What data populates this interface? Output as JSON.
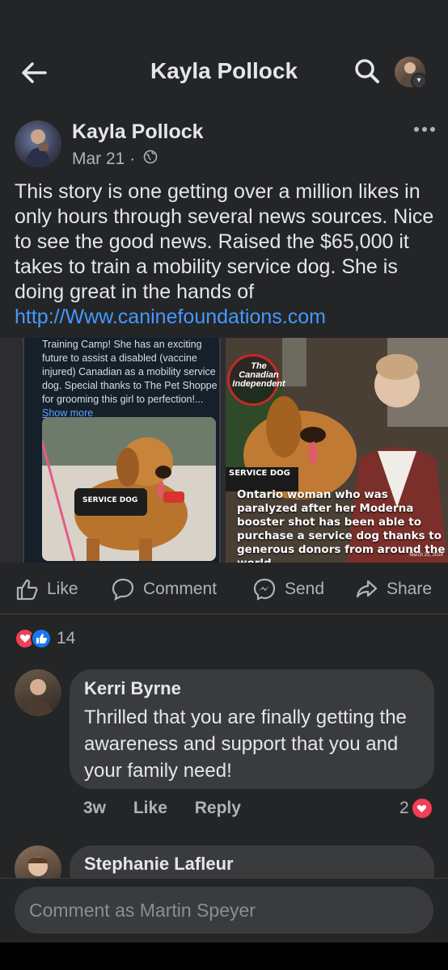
{
  "header": {
    "title": "Kayla Pollock"
  },
  "post": {
    "author": "Kayla Pollock",
    "date": "Mar 21 ·",
    "text": "This story is one getting over a million likes in only hours through several news sources. Nice to see the good news. Raised the $65,000 it takes to train a mobility service dog. She is doing great in the hands of ",
    "link": "http://Www.caninefoundations.com",
    "media": {
      "left_text": "Training Camp! She has an exciting future to assist a disabled (vaccine injured) Canadian as a mobility service dog. Special thanks to The Pet Shoppe for grooming this girl to perfection!...",
      "left_show_more": "Show more",
      "vest_label": "SERVICE DOG",
      "news_logo": "The Canadian Independent",
      "news_vest_label": "SERVICE DOG",
      "news_caption": "Ontario woman who was paralyzed after her Moderna booster shot has been able to purchase a service dog thanks to generous donors from around the world",
      "news_date": "March 20, 2024"
    }
  },
  "actions": {
    "like": "Like",
    "comment": "Comment",
    "send": "Send",
    "share": "Share"
  },
  "reactions": {
    "count": "14",
    "colors": {
      "love": "#f33e58",
      "like": "#1877f2"
    }
  },
  "comments": [
    {
      "author": "Kerri Byrne",
      "text": "Thrilled that you are finally getting the awareness and support that you and your family need!",
      "time": "3w",
      "like_label": "Like",
      "reply_label": "Reply",
      "reaction_count": "2"
    },
    {
      "author": "Stephanie Lafleur"
    }
  ],
  "composer": {
    "placeholder": "Comment as Martin Speyer"
  }
}
